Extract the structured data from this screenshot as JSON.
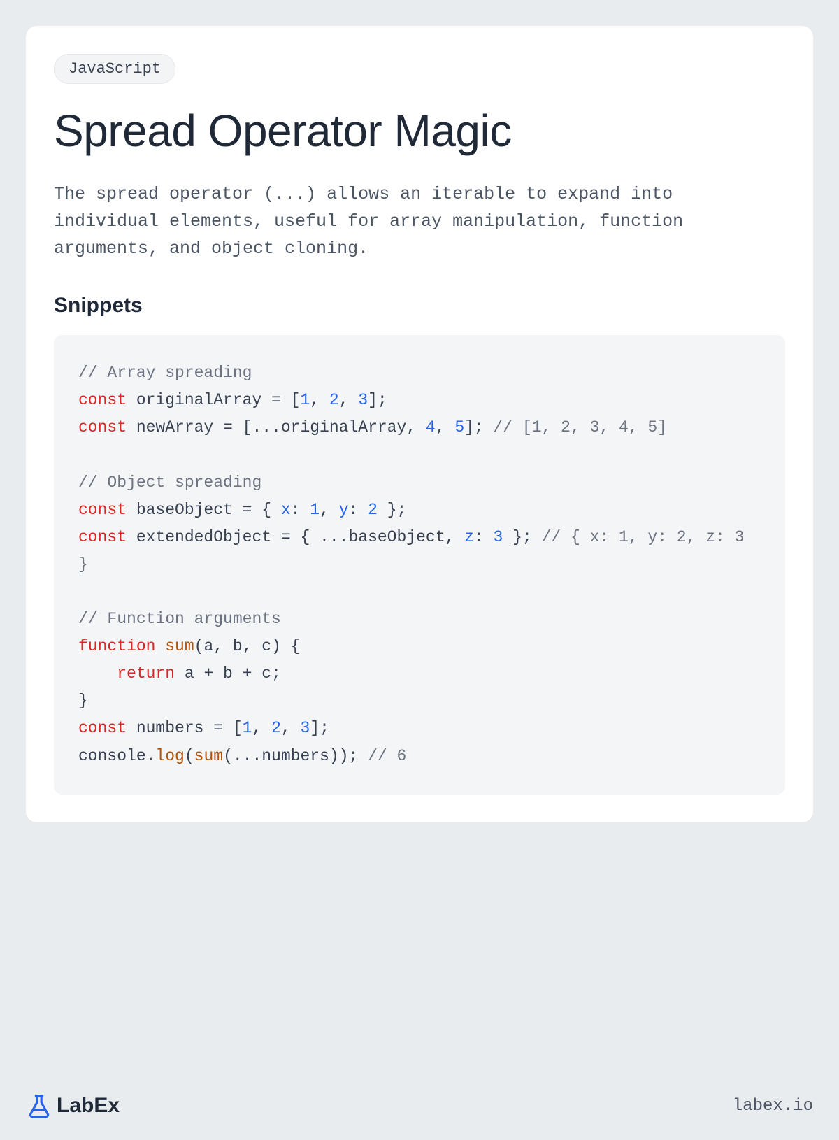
{
  "badge": "JavaScript",
  "title": "Spread Operator Magic",
  "description": "The spread operator (...) allows an iterable to expand into individual elements, useful for array manipulation, function arguments, and object cloning.",
  "section_heading": "Snippets",
  "code": {
    "tokens": [
      {
        "cls": "tok-comment",
        "t": "// Array spreading"
      },
      {
        "t": "\n"
      },
      {
        "cls": "tok-keyword",
        "t": "const"
      },
      {
        "t": " originalArray = ["
      },
      {
        "cls": "tok-number",
        "t": "1"
      },
      {
        "t": ", "
      },
      {
        "cls": "tok-number",
        "t": "2"
      },
      {
        "t": ", "
      },
      {
        "cls": "tok-number",
        "t": "3"
      },
      {
        "t": "];"
      },
      {
        "t": "\n"
      },
      {
        "cls": "tok-keyword",
        "t": "const"
      },
      {
        "t": " newArray = [...originalArray, "
      },
      {
        "cls": "tok-number",
        "t": "4"
      },
      {
        "t": ", "
      },
      {
        "cls": "tok-number",
        "t": "5"
      },
      {
        "t": "]; "
      },
      {
        "cls": "tok-comment",
        "t": "// [1, 2, 3, 4, 5]"
      },
      {
        "t": "\n"
      },
      {
        "t": "\n"
      },
      {
        "cls": "tok-comment",
        "t": "// Object spreading"
      },
      {
        "t": "\n"
      },
      {
        "cls": "tok-keyword",
        "t": "const"
      },
      {
        "t": " baseObject = { "
      },
      {
        "cls": "tok-prop",
        "t": "x"
      },
      {
        "t": ": "
      },
      {
        "cls": "tok-number",
        "t": "1"
      },
      {
        "t": ", "
      },
      {
        "cls": "tok-prop",
        "t": "y"
      },
      {
        "t": ": "
      },
      {
        "cls": "tok-number",
        "t": "2"
      },
      {
        "t": " };"
      },
      {
        "t": "\n"
      },
      {
        "cls": "tok-keyword",
        "t": "const"
      },
      {
        "t": " extendedObject = { ...baseObject, "
      },
      {
        "cls": "tok-prop",
        "t": "z"
      },
      {
        "t": ": "
      },
      {
        "cls": "tok-number",
        "t": "3"
      },
      {
        "t": " }; "
      },
      {
        "cls": "tok-comment",
        "t": "// { x: 1, y: 2, z: 3 }"
      },
      {
        "t": "\n"
      },
      {
        "t": "\n"
      },
      {
        "cls": "tok-comment",
        "t": "// Function arguments"
      },
      {
        "t": "\n"
      },
      {
        "cls": "tok-keyword",
        "t": "function"
      },
      {
        "t": " "
      },
      {
        "cls": "tok-func",
        "t": "sum"
      },
      {
        "t": "(a, b, c) {"
      },
      {
        "t": "\n"
      },
      {
        "t": "    "
      },
      {
        "cls": "tok-keyword",
        "t": "return"
      },
      {
        "t": " a + b + c;"
      },
      {
        "t": "\n"
      },
      {
        "t": "}"
      },
      {
        "t": "\n"
      },
      {
        "cls": "tok-keyword",
        "t": "const"
      },
      {
        "t": " numbers = ["
      },
      {
        "cls": "tok-number",
        "t": "1"
      },
      {
        "t": ", "
      },
      {
        "cls": "tok-number",
        "t": "2"
      },
      {
        "t": ", "
      },
      {
        "cls": "tok-number",
        "t": "3"
      },
      {
        "t": "];"
      },
      {
        "t": "\n"
      },
      {
        "t": "console."
      },
      {
        "cls": "tok-func",
        "t": "log"
      },
      {
        "t": "("
      },
      {
        "cls": "tok-func",
        "t": "sum"
      },
      {
        "t": "(...numbers)); "
      },
      {
        "cls": "tok-comment",
        "t": "// 6"
      }
    ]
  },
  "brand": "LabEx",
  "footer_url": "labex.io",
  "colors": {
    "page_bg": "#e9ecef",
    "card_bg": "#ffffff",
    "code_bg": "#f4f5f7",
    "text_primary": "#1f2937",
    "text_secondary": "#4b5563",
    "accent_blue": "#2563eb",
    "keyword_red": "#dc2626",
    "func_orange": "#b45309",
    "comment_gray": "#6b7280"
  }
}
